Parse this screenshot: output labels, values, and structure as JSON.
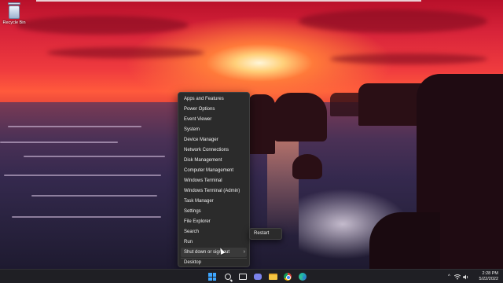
{
  "desktop": {
    "icons": [
      {
        "label": "Recycle Bin",
        "icon": "recycle-bin-icon"
      }
    ]
  },
  "context_menu": {
    "items": [
      {
        "label": "Apps and Features"
      },
      {
        "label": "Power Options"
      },
      {
        "label": "Event Viewer"
      },
      {
        "label": "System"
      },
      {
        "label": "Device Manager"
      },
      {
        "label": "Network Connections"
      },
      {
        "label": "Disk Management"
      },
      {
        "label": "Computer Management"
      },
      {
        "label": "Windows Terminal"
      },
      {
        "label": "Windows Terminal (Admin)"
      },
      {
        "label": "Task Manager"
      },
      {
        "label": "Settings"
      },
      {
        "label": "File Explorer"
      },
      {
        "label": "Search"
      },
      {
        "label": "Run"
      },
      {
        "label": "Shut down or sign out",
        "submenu": true
      },
      {
        "label": "Desktop"
      }
    ],
    "submenu": {
      "items": [
        {
          "label": "Restart"
        }
      ]
    }
  },
  "taskbar": {
    "apps": [
      {
        "name": "start",
        "icon": "windows-logo-icon"
      },
      {
        "name": "search",
        "icon": "search-icon"
      },
      {
        "name": "task-view",
        "icon": "task-view-icon"
      },
      {
        "name": "chat",
        "icon": "chat-icon"
      },
      {
        "name": "file-explorer",
        "icon": "folder-icon"
      },
      {
        "name": "chrome",
        "icon": "chrome-icon"
      },
      {
        "name": "edge",
        "icon": "edge-icon"
      }
    ],
    "tray": {
      "chevron": "^",
      "time": "2:28 PM",
      "date": "5/22/2022"
    }
  },
  "colors": {
    "menu_bg": "#2b2b2b",
    "taskbar_bg": "#1f1f24",
    "accent": "#3ea6ff"
  }
}
